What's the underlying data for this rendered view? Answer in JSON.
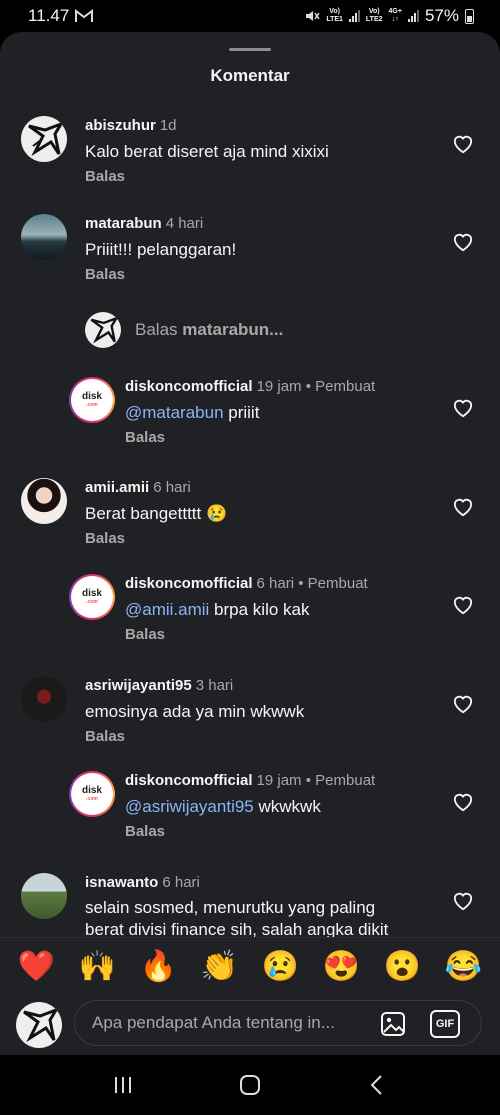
{
  "status_bar": {
    "time": "11.47",
    "carrier_icon": "gmail-m-icon",
    "sim1": "LTE1",
    "sim1_top": "Vo)",
    "sim2": "LTE2",
    "sim2_top": "Vo)",
    "network": "4G+",
    "battery": "57%"
  },
  "sheet": {
    "title": "Komentar"
  },
  "comments": [
    {
      "username": "abiszuhur",
      "time": "1d",
      "text": "Kalo berat diseret aja mind xixixi",
      "reply_label": "Balas"
    },
    {
      "username": "matarabun",
      "time": "4 hari",
      "text": "Priiit!!! pelanggaran!",
      "reply_label": "Balas"
    },
    {
      "username": "amii.amii",
      "time": "6 hari",
      "text": "Berat bangettttt 😢",
      "reply_label": "Balas"
    },
    {
      "username": "asriwijayanti95",
      "time": "3 hari",
      "text": "emosinya ada ya min wkwwk",
      "reply_label": "Balas"
    },
    {
      "username": "isnawanto",
      "time": "6 hari",
      "text_line1": "selain sosmed, menurutku yang paling",
      "text_line2": "berat divisi finance sih, salah angka dikit"
    }
  ],
  "reply_prompt": {
    "prefix": "Balas",
    "target": "matarabun..."
  },
  "replies": [
    {
      "username": "diskoncomofficial",
      "time": "19 jam",
      "creator": "Pembuat",
      "mention": "@matarabun",
      "text": " priiit",
      "reply_label": "Balas"
    },
    {
      "username": "diskoncomofficial",
      "time": "6 hari",
      "creator": "Pembuat",
      "mention": "@amii.amii",
      "text": " brpa kilo kak",
      "reply_label": "Balas"
    },
    {
      "username": "diskoncomofficial",
      "time": "19 jam",
      "creator": "Pembuat",
      "mention": "@asriwijayanti95",
      "text": " wkwkwk",
      "reply_label": "Balas"
    }
  ],
  "brand_avatar": {
    "name": "disk",
    "o": "o",
    "n": "n",
    "dom": ".com"
  },
  "emoji_bar": [
    "❤️",
    "🙌",
    "🔥",
    "👏",
    "😢",
    "😍",
    "😮",
    "😂"
  ],
  "composer": {
    "placeholder": "Apa pendapat Anda tentang in...",
    "gif_label": "GIF"
  },
  "creator_dot": "•",
  "colors": {
    "sheet_bg": "#202124",
    "mention": "#8ab4f8",
    "muted": "#a8a8a8"
  }
}
